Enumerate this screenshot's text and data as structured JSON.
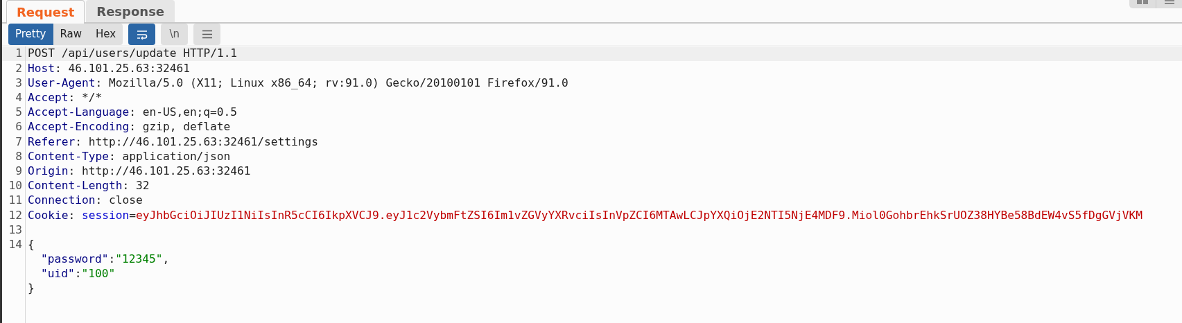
{
  "tabs": [
    {
      "label": "Request",
      "selected": true
    },
    {
      "label": "Response",
      "selected": false
    }
  ],
  "view_modes": [
    {
      "label": "Pretty",
      "selected": true
    },
    {
      "label": "Raw",
      "selected": false
    },
    {
      "label": "Hex",
      "selected": false
    }
  ],
  "toggles": [
    {
      "kind": "wrap",
      "on": true
    },
    {
      "kind": "newline",
      "label": "\\n",
      "on": false
    },
    {
      "kind": "menu",
      "on": false
    }
  ],
  "lines": [
    {
      "number": "1",
      "kind": "plain",
      "text": "POST /api/users/update HTTP/1.1",
      "current": true
    },
    {
      "number": "2",
      "kind": "header",
      "name": "Host",
      "sep": ":",
      "value": "46.101.25.63:32461",
      "current": false
    },
    {
      "number": "3",
      "kind": "header",
      "name": "User-Agent",
      "sep": ":",
      "value": "Mozilla/5.0 (X11; Linux x86_64; rv:91.0) Gecko/20100101 Firefox/91.0",
      "current": false
    },
    {
      "number": "4",
      "kind": "header",
      "name": "Accept",
      "sep": ":",
      "value": "*/*",
      "current": false
    },
    {
      "number": "5",
      "kind": "header",
      "name": "Accept-Language",
      "sep": ":",
      "value": "en-US,en;q=0.5",
      "current": false
    },
    {
      "number": "6",
      "kind": "header",
      "name": "Accept-Encoding",
      "sep": ":",
      "value": "gzip, deflate",
      "current": false
    },
    {
      "number": "7",
      "kind": "header",
      "name": "Referer",
      "sep": ":",
      "value": "http://46.101.25.63:32461/settings",
      "current": false
    },
    {
      "number": "8",
      "kind": "header",
      "name": "Content-Type",
      "sep": ":",
      "value": "application/json",
      "current": false
    },
    {
      "number": "9",
      "kind": "header",
      "name": "Origin",
      "sep": ":",
      "value": "http://46.101.25.63:32461",
      "current": false
    },
    {
      "number": "10",
      "kind": "header",
      "name": "Content-Length",
      "sep": ":",
      "value": "32",
      "current": false
    },
    {
      "number": "11",
      "kind": "header",
      "name": "Connection",
      "sep": ":",
      "value": "close",
      "current": false
    },
    {
      "number": "12",
      "kind": "cookie",
      "name": "Cookie",
      "sep": ":",
      "cookie_name": "session",
      "eq": "=",
      "cookie_value": "eyJhbGciOiJIUzI1NiIsInR5cCI6IkpXVCJ9.eyJ1c2VybmFtZSI6Im1vZGVyYXRvciIsInVpZCI6MTAwLCJpYXQiOjE2NTI5NjE4MDF9.Miol0GohbrEhkSrUOZ38HYBe58BdEW4vS5fDgGVjVKM",
      "current": false
    },
    {
      "number": "13",
      "kind": "blank",
      "current": false
    },
    {
      "number": "14",
      "kind": "plain",
      "text": "{",
      "current": false
    },
    {
      "kind": "json_pair",
      "key": "\"password\"",
      "colon": ":",
      "value": "\"12345\"",
      "trail": ",",
      "current": false
    },
    {
      "kind": "json_pair",
      "key": "\"uid\"",
      "colon": ":",
      "value": "\"100\"",
      "current": false
    },
    {
      "kind": "plain",
      "text": "}",
      "current": false
    }
  ]
}
